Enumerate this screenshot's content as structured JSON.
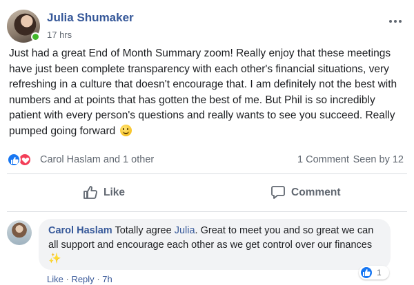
{
  "post": {
    "author": "Julia Shumaker",
    "time": "17 hrs",
    "text": "Just had a great End of Month Summary zoom! Really enjoy that these meetings have just been complete transparency with each other's financial situations, very refreshing in a culture that doesn't encourage that. I am definitely not the best with numbers and at points that has gotten the best of me. But Phil is so incredibly patient with every person's questions and really wants to see you succeed. Really pumped going forward",
    "emoji": "slightly-smiling-face-icon"
  },
  "reactions": {
    "types": [
      "like-reaction-icon",
      "love-reaction-icon"
    ],
    "reactors": "Carol Haslam and 1 other",
    "comments": "1 Comment",
    "seen": "Seen by 12"
  },
  "actions": {
    "like": "Like",
    "comment": "Comment"
  },
  "comment": {
    "author": "Carol Haslam",
    "text_before": "Totally agree ",
    "mention": "Julia",
    "text_after": ". Great to meet you and so great we can all support and encourage each other as we get control over our finances ",
    "emoji": "✨",
    "like_count": "1",
    "like_label": "Like",
    "reply_label": "Reply",
    "time": "7h"
  },
  "colors": {
    "link": "#365899",
    "like_blue": "#1877f2",
    "love_red": "#f33e58",
    "muted": "#606770",
    "bubble": "#f2f3f5"
  }
}
